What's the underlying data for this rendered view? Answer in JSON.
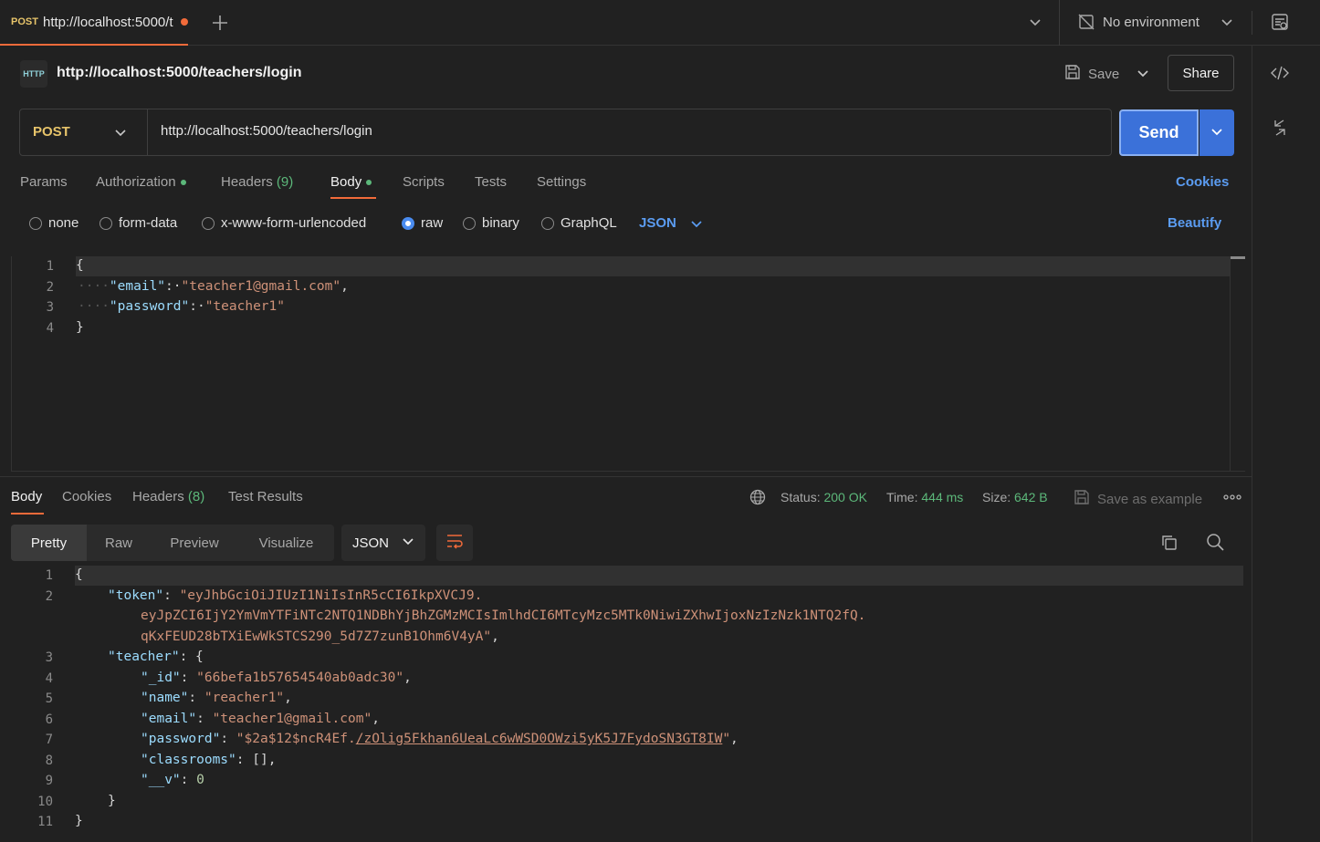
{
  "tab": {
    "method": "POST",
    "url": "http://localhost:5000/t"
  },
  "environment": {
    "label": "No environment"
  },
  "request": {
    "title": "http://localhost:5000/teachers/login",
    "http_badge": "HTTP",
    "method": "POST",
    "url": "http://localhost:5000/teachers/login",
    "save_label": "Save",
    "share_label": "Share",
    "send_label": "Send"
  },
  "req_tabs": {
    "params": "Params",
    "authorization": "Authorization",
    "headers": "Headers",
    "headers_count": "(9)",
    "body": "Body",
    "scripts": "Scripts",
    "tests": "Tests",
    "settings": "Settings",
    "cookies": "Cookies"
  },
  "body_types": {
    "none": "none",
    "form_data": "form-data",
    "urlencoded": "x-www-form-urlencoded",
    "raw": "raw",
    "binary": "binary",
    "graphql": "GraphQL",
    "format": "JSON",
    "beautify": "Beautify"
  },
  "request_body": {
    "line_numbers": [
      "1",
      "2",
      "3",
      "4"
    ],
    "open": "{",
    "close": "}",
    "email_key": "\"email\"",
    "email_val": "\"teacher1@gmail.com\"",
    "password_key": "\"password\"",
    "password_val": "\"teacher1\""
  },
  "response": {
    "tabs": {
      "body": "Body",
      "cookies": "Cookies",
      "headers": "Headers",
      "headers_count": "(8)",
      "test_results": "Test Results"
    },
    "status_label": "Status:",
    "status_value": "200 OK",
    "time_label": "Time:",
    "time_value": "444 ms",
    "size_label": "Size:",
    "size_value": "642 B",
    "save_example": "Save as example",
    "views": {
      "pretty": "Pretty",
      "raw": "Raw",
      "preview": "Preview",
      "visualize": "Visualize"
    },
    "format": "JSON",
    "line_numbers": [
      "1",
      "2",
      "3",
      "4",
      "5",
      "6",
      "7",
      "8",
      "9",
      "10",
      "11"
    ],
    "token_key": "\"token\"",
    "token_part1": "\"eyJhbGciOiJIUzI1NiIsInR5cCI6IkpXVCJ9.",
    "token_part2": "eyJpZCI6IjY2YmVmYTFiNTc2NTQ1NDBhYjBhZGMzMCIsImlhdCI6MTcyMzc5MTk0NiwiZXhwIjoxNzIzNzk1NTQ2fQ.",
    "token_part3": "qKxFEUD28bTXiEwWkSTCS290_5d7Z7zunB1Ohm6V4yA\"",
    "teacher_key": "\"teacher\"",
    "id_key": "\"_id\"",
    "id_val": "\"66befa1b57654540ab0adc30\"",
    "name_key": "\"name\"",
    "name_val": "\"reacher1\"",
    "email_key": "\"email\"",
    "email_val": "\"teacher1@gmail.com\"",
    "password_key": "\"password\"",
    "password_val_a": "\"$2a$12$ncR4Ef.",
    "password_val_b": "/zOlig5Fkhan6UeaLc6wWSD0OWzi5yK5J7FydoSN3GT8IW",
    "password_val_c": "\"",
    "classrooms_key": "\"classrooms\"",
    "classrooms_val": "[]",
    "v_key": "\"__v\"",
    "v_val": "0"
  },
  "colors": {
    "accent": "#f26b3a",
    "send": "#3b71d9",
    "link": "#5b9cf1",
    "ok": "#5cb87a",
    "method": "#e7c46a"
  }
}
